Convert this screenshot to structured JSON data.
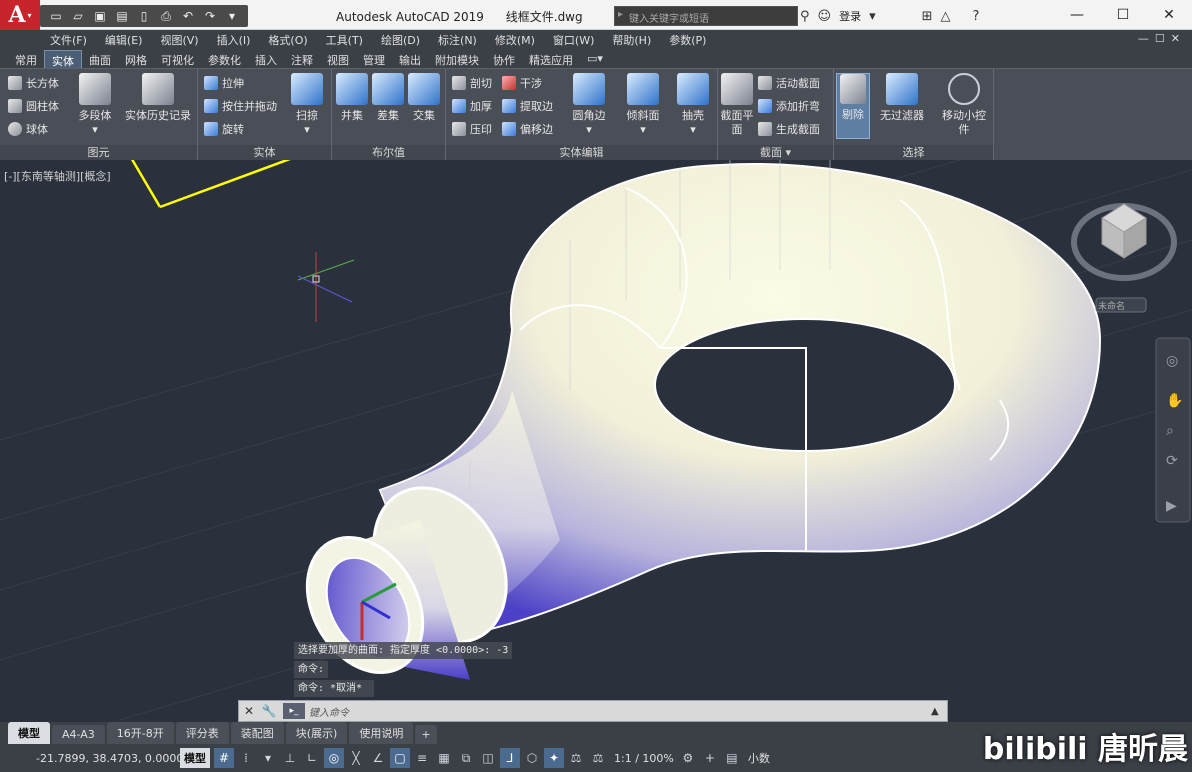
{
  "titlebar": {
    "app_logo": "A",
    "app_name": "Autodesk AutoCAD 2019",
    "file_name": "线框文件.dwg",
    "search_placeholder": "键入关键字或短语",
    "login": "登录"
  },
  "menubar": [
    "文件(F)",
    "编辑(E)",
    "视图(V)",
    "插入(I)",
    "格式(O)",
    "工具(T)",
    "绘图(D)",
    "标注(N)",
    "修改(M)",
    "窗口(W)",
    "帮助(H)",
    "参数(P)"
  ],
  "ribbon_tabs": [
    "常用",
    "实体",
    "曲面",
    "网格",
    "可视化",
    "参数化",
    "插入",
    "注释",
    "视图",
    "管理",
    "输出",
    "附加模块",
    "协作",
    "精选应用"
  ],
  "ribbon": {
    "primitive": {
      "label": "图元",
      "box": "长方体",
      "cylinder": "圆柱体",
      "sphere": "球体",
      "polysolid": "多段体",
      "history": "实体历史记录"
    },
    "solid": {
      "label": "实体",
      "extrude": "拉伸",
      "presspull": "按住并拖动",
      "revolve": "旋转",
      "sweep": "扫掠"
    },
    "boolean": {
      "label": "布尔值",
      "union": "并集",
      "subtract": "差集",
      "intersect": "交集"
    },
    "solid_edit": {
      "label": "实体编辑",
      "slice": "剖切",
      "interfere": "干涉",
      "thicken": "加厚",
      "extract_edges": "提取边",
      "imprint": "压印",
      "offset_edges": "偏移边",
      "fillet_edge": "圆角边",
      "taper_face": "倾斜面",
      "shell": "抽壳"
    },
    "section": {
      "label": "截面",
      "section_plane": "截面平面",
      "live_section": "活动截面",
      "add_jog": "添加折弯",
      "generate_section": "生成截面"
    },
    "selection": {
      "label": "选择",
      "culling": "剔除",
      "no_filter": "无过滤器",
      "gizmo": "移动小控件"
    }
  },
  "viewport": {
    "view_label": "[-][东南等轴测][概念]",
    "viewcube_label": "未命名"
  },
  "command_history": [
    "选择要加厚的曲面:  指定厚度 <0.0000>: -3",
    "命令:",
    "命令: *取消*"
  ],
  "command_input": {
    "placeholder": "键入命令"
  },
  "layout_tabs": [
    "模型",
    "A4-A3",
    "16开-8开",
    "评分表",
    "装配图",
    "块(展示)",
    "使用说明"
  ],
  "statusbar": {
    "coordinates": "-21.7899, 38.4703, 0.0000",
    "model": "模型",
    "scale": "1:1 / 100%",
    "units": "小数"
  },
  "watermark": "bilibili 唐昕晨"
}
